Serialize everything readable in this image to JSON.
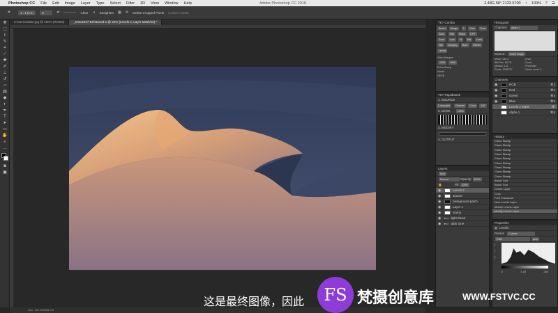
{
  "menubar": {
    "app": "Photoshop CC",
    "items": [
      "File",
      "Edit",
      "Image",
      "Layer",
      "Type",
      "Select",
      "Filter",
      "3D",
      "View",
      "Window",
      "Help"
    ],
    "title": "Adobe Photoshop CC 2018",
    "status": "2.48G 58° 2133 5700",
    "time": "100%"
  },
  "options": {
    "ratio_label": "1 : 1 (1:1)",
    "ratio_value": "5",
    "clear_label": "Clear",
    "straighten_label": "Straighten",
    "delete_label": "Delete Cropped Pixels",
    "content_aware_label": "Content-Aware"
  },
  "tabs": [
    {
      "label": "2-intermediate.jpg @ 100% (RGB/8)"
    },
    {
      "label": "_DSC2247-Enhanced-1 @ 25% (Levels 2, Layer Mask/16) *"
    }
  ],
  "statusbar": {
    "text": "Doc: 122.9M/685.7M"
  },
  "tk_combo": {
    "title": "TK7 Combo",
    "buttons": [
      "Smart",
      "Merge",
      "1",
      "Gain",
      "Tone",
      "Save",
      "Edit",
      "Mask",
      "CPY",
      "Zone",
      "Lum",
      "Hi",
      "Sat",
      "Load",
      "WB",
      "Dodging",
      "Burn",
      "Painter",
      "Levels"
    ],
    "side_labels": [
      "Web Sharpen",
      "Extra Sharp",
      "Inbuilt",
      "sRGB"
    ],
    "fields": [
      "1200",
      "1800"
    ]
  },
  "rapidmask": {
    "title": "TK7 RapidMask",
    "source_title": "1. SOURCE",
    "source_buttons": [
      "Composite",
      "Channel",
      "Color",
      "SAT"
    ],
    "mask_title": "2. MASK",
    "mask_value": "100%",
    "modify_title": "3. MODIFY",
    "output_title": "4. OUTPUT"
  },
  "layers": {
    "title": "Layers",
    "kind_label": "Kind",
    "blend_mode": "Normal",
    "opacity_label": "Opacity:",
    "opacity": "100%",
    "fill_label": "Fill:",
    "fill": "100%",
    "items": [
      {
        "name": "Levels 2",
        "thumb": "white",
        "selected": true
      },
      {
        "name": "square",
        "thumb": "white",
        "selected": false
      },
      {
        "name": "background patch",
        "thumb": "dark",
        "selected": false
      },
      {
        "name": "Layer 1",
        "thumb": "white",
        "selected": false
      },
      {
        "name": "stamp",
        "thumb": "white",
        "selected": false
      },
      {
        "name": "light blend",
        "thumb": "none",
        "selected": false
      },
      {
        "name": "dark tone",
        "thumb": "none",
        "selected": false
      }
    ]
  },
  "histogram": {
    "title": "Histogram",
    "channel_label": "Channel:",
    "channel_value": "Alpha 1",
    "source_label": "Source:",
    "source_value": "Entire Image",
    "stats": [
      "Mean: 130.4",
      "Std Dev: 54.78",
      "Median: 131",
      "Pixels: 2085757",
      "Level:",
      "Count:",
      "Percentile:",
      "Cache Level: 4"
    ]
  },
  "channels": {
    "title": "Channels",
    "items": [
      {
        "name": "RGB",
        "shortcut": "⌘2"
      },
      {
        "name": "Red",
        "shortcut": "⌘3"
      },
      {
        "name": "Green",
        "shortcut": "⌘4"
      },
      {
        "name": "Blue",
        "shortcut": "⌘5"
      },
      {
        "name": "Levels 2 Mask",
        "shortcut": "⌘\\"
      },
      {
        "name": "Alpha 1",
        "shortcut": "⌘6"
      }
    ]
  },
  "history": {
    "title": "History",
    "items": [
      "Clone Stamp",
      "Clone Stamp",
      "Clone Stamp",
      "Clone Stamp",
      "Clone Stamp",
      "Clone Stamp",
      "Clone Stamp",
      "Clone Stamp",
      "Clone Stamp",
      "Brush Tool",
      "Brush Tool",
      "Delete Layer",
      "Crop",
      "Free Transform",
      "New Levels Layer",
      "Modify Levels Layer",
      "Modify Levels Layer"
    ]
  },
  "properties": {
    "title": "Properties",
    "subtitle": "Levels",
    "preset_label": "Preset:",
    "preset_value": "Custom",
    "channel_value": "RGB",
    "auto_label": "Auto",
    "levels": [
      "0",
      "1.00",
      "255"
    ]
  },
  "overlay": {
    "subtitle": "这是最终图像，因此",
    "logo": "FS",
    "brand": "梵摄创意库",
    "url": "WWW.FSTVC.CC"
  },
  "colors": {
    "accent": "#8e3bd8",
    "selection": "#5e5e5e",
    "panel": "#3a3a3a"
  }
}
